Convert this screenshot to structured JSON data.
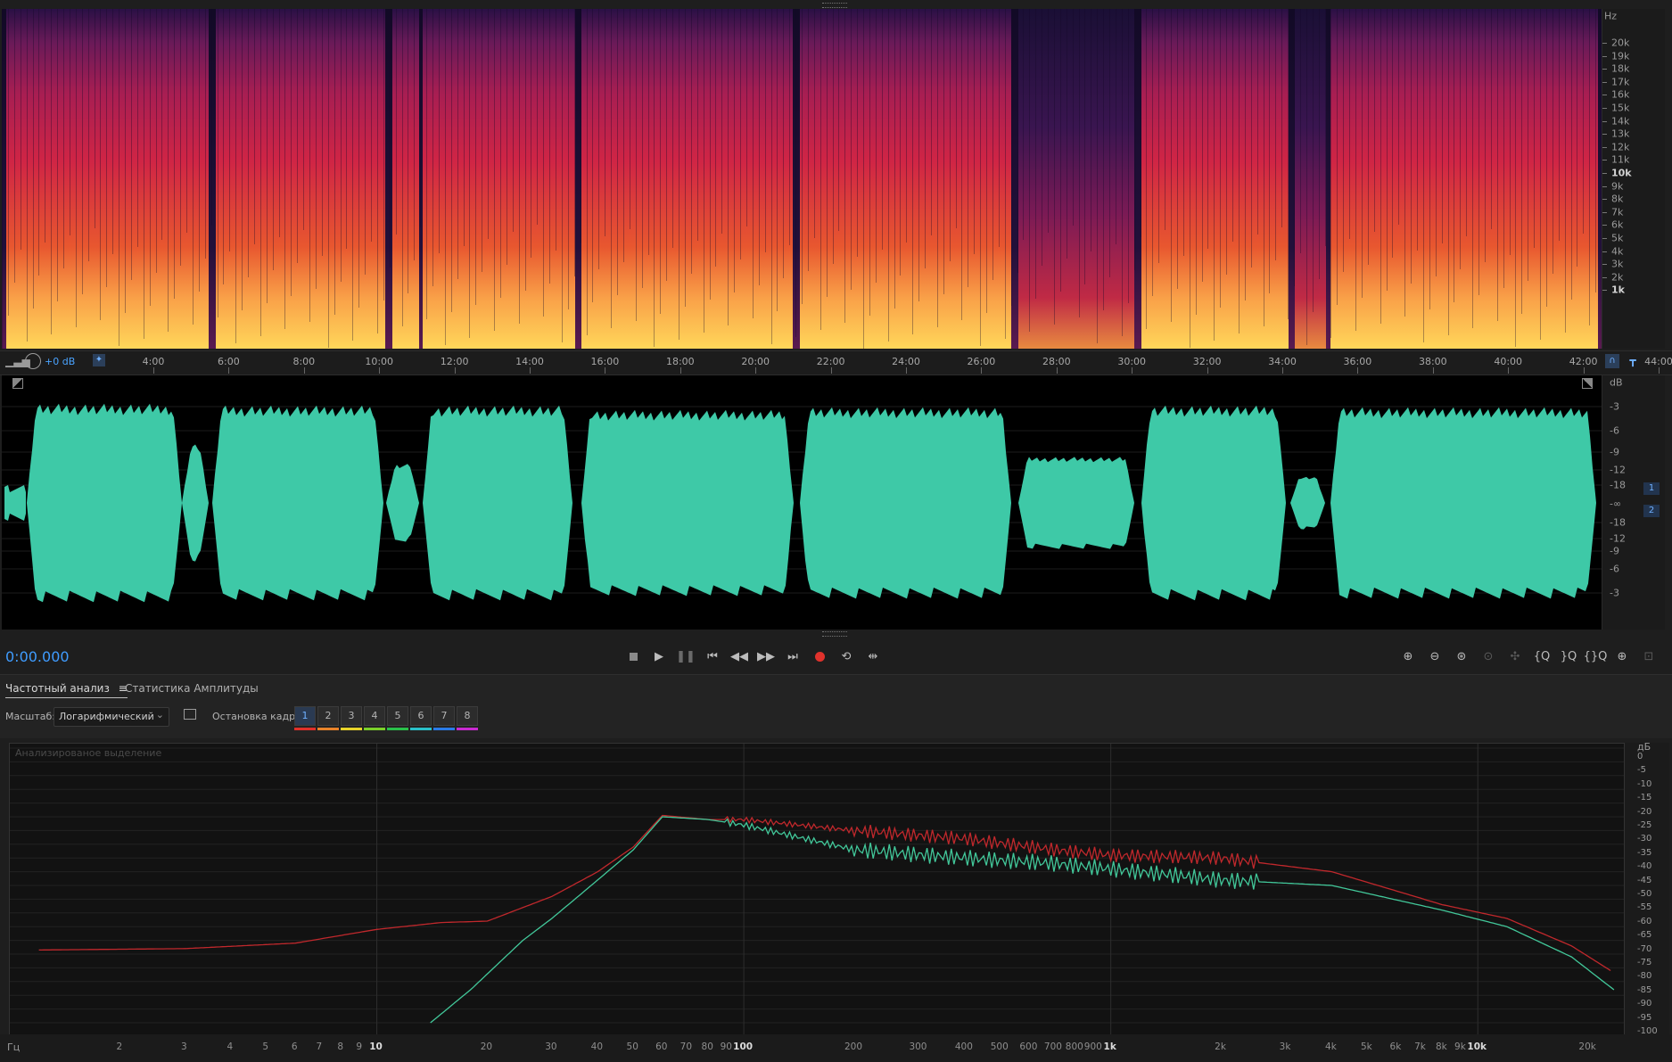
{
  "spectrogram": {
    "hz_unit": "Hz",
    "hz_labels": [
      "20k",
      "19k",
      "18k",
      "17k",
      "16k",
      "15k",
      "14k",
      "13k",
      "12k",
      "11k",
      "10k",
      "9k",
      "8k",
      "7k",
      "6k",
      "5k",
      "4k",
      "3k",
      "2k",
      "1k"
    ],
    "colors": {
      "low": "#1a0f35",
      "mid": "#d02545",
      "high": "#ffd75a"
    }
  },
  "timeline": {
    "gain_label": "+0 dB",
    "time_labels": [
      "4:00",
      "6:00",
      "8:00",
      "10:00",
      "12:00",
      "14:00",
      "16:00",
      "18:00",
      "20:00",
      "22:00",
      "24:00",
      "26:00",
      "28:00",
      "30:00",
      "32:00",
      "34:00",
      "36:00",
      "38:00",
      "40:00",
      "42:00",
      "44:00"
    ]
  },
  "waveform": {
    "color": "#3ec9a7",
    "db_unit": "dB",
    "db_labels": [
      "-3",
      "-6",
      "-9",
      "-12",
      "-18",
      "-∞",
      "-18",
      "-12",
      "-9",
      "-6",
      "-3"
    ],
    "channels": [
      "1",
      "2"
    ]
  },
  "transport": {
    "current_time": "0:00.000"
  },
  "panel": {
    "tabs": {
      "frequency": "Частотный анализ",
      "amplitude": "Статистика Амплитуды"
    },
    "scale_label": "Масштаб:",
    "scale_value": "Логарифмический",
    "freeze_label": "Остановка кадра:",
    "freeze_slots": [
      {
        "label": "1",
        "color": "#e0302a"
      },
      {
        "label": "2",
        "color": "#e8832a"
      },
      {
        "label": "3",
        "color": "#e8d32a"
      },
      {
        "label": "4",
        "color": "#7bd02a"
      },
      {
        "label": "5",
        "color": "#2ac04a"
      },
      {
        "label": "6",
        "color": "#2ac0c8"
      },
      {
        "label": "7",
        "color": "#2a7be8"
      },
      {
        "label": "8",
        "color": "#c82ad0"
      }
    ]
  },
  "frequency_graph": {
    "watermark": "Анализированое выделение",
    "y_unit": "дБ",
    "y_labels": [
      "0",
      "-5",
      "-10",
      "-15",
      "-20",
      "-25",
      "-30",
      "-35",
      "-40",
      "-45",
      "-50",
      "-55",
      "-60",
      "-65",
      "-70",
      "-75",
      "-80",
      "-85",
      "-90",
      "-95",
      "-100"
    ],
    "x_unit": "Гц",
    "x_labels": [
      "2",
      "3",
      "4",
      "5",
      "6",
      "7",
      "8",
      "9",
      "10",
      "20",
      "30",
      "40",
      "50",
      "60",
      "70",
      "80",
      "90",
      "100",
      "200",
      "300",
      "400",
      "500",
      "600",
      "700",
      "800",
      "900",
      "1k",
      "2k",
      "3k",
      "4k",
      "5k",
      "6k",
      "7k",
      "8k",
      "9k",
      "10k",
      "20k"
    ],
    "line_colors": {
      "red": "#c0282c",
      "green": "#42c89a"
    }
  }
}
